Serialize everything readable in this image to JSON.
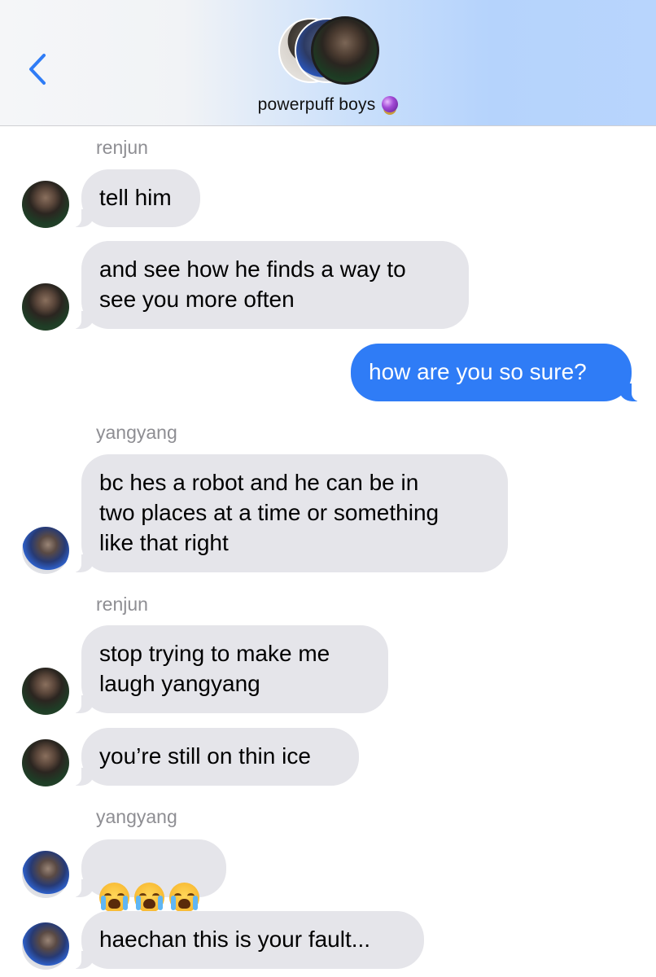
{
  "header": {
    "title": "powerpuff boys",
    "title_icon": "crystal-ball-icon",
    "back_icon": "chevron-left-icon"
  },
  "colors": {
    "incoming_bubble": "#e5e5ea",
    "outgoing_bubble": "#2f7cf6",
    "sender_label": "#8e8e93",
    "accent": "#2f7cf6"
  },
  "messages": [
    {
      "sender": "renjun"
    },
    {
      "text": "tell him",
      "direction": "incoming",
      "author": "renjun"
    },
    {
      "text": "and see how he finds a way to\nsee you more often",
      "direction": "incoming",
      "author": "renjun"
    },
    {
      "text": "how are you so sure?",
      "direction": "outgoing"
    },
    {
      "sender": "yangyang"
    },
    {
      "text": "bc hes a robot and he can be in\ntwo places at a time or something\nlike that right",
      "direction": "incoming",
      "author": "yangyang"
    },
    {
      "sender": "renjun"
    },
    {
      "text": "stop trying to make me\nlaugh yangyang",
      "direction": "incoming",
      "author": "renjun"
    },
    {
      "text": "you’re still on thin ice",
      "direction": "incoming",
      "author": "renjun"
    },
    {
      "sender": "yangyang"
    },
    {
      "emoji": [
        "loudly-crying-face-icon",
        "loudly-crying-face-icon",
        "loudly-crying-face-icon"
      ],
      "direction": "incoming",
      "author": "yangyang"
    },
    {
      "text": "haechan this is your fault...",
      "direction": "incoming",
      "author": "yangyang"
    }
  ]
}
